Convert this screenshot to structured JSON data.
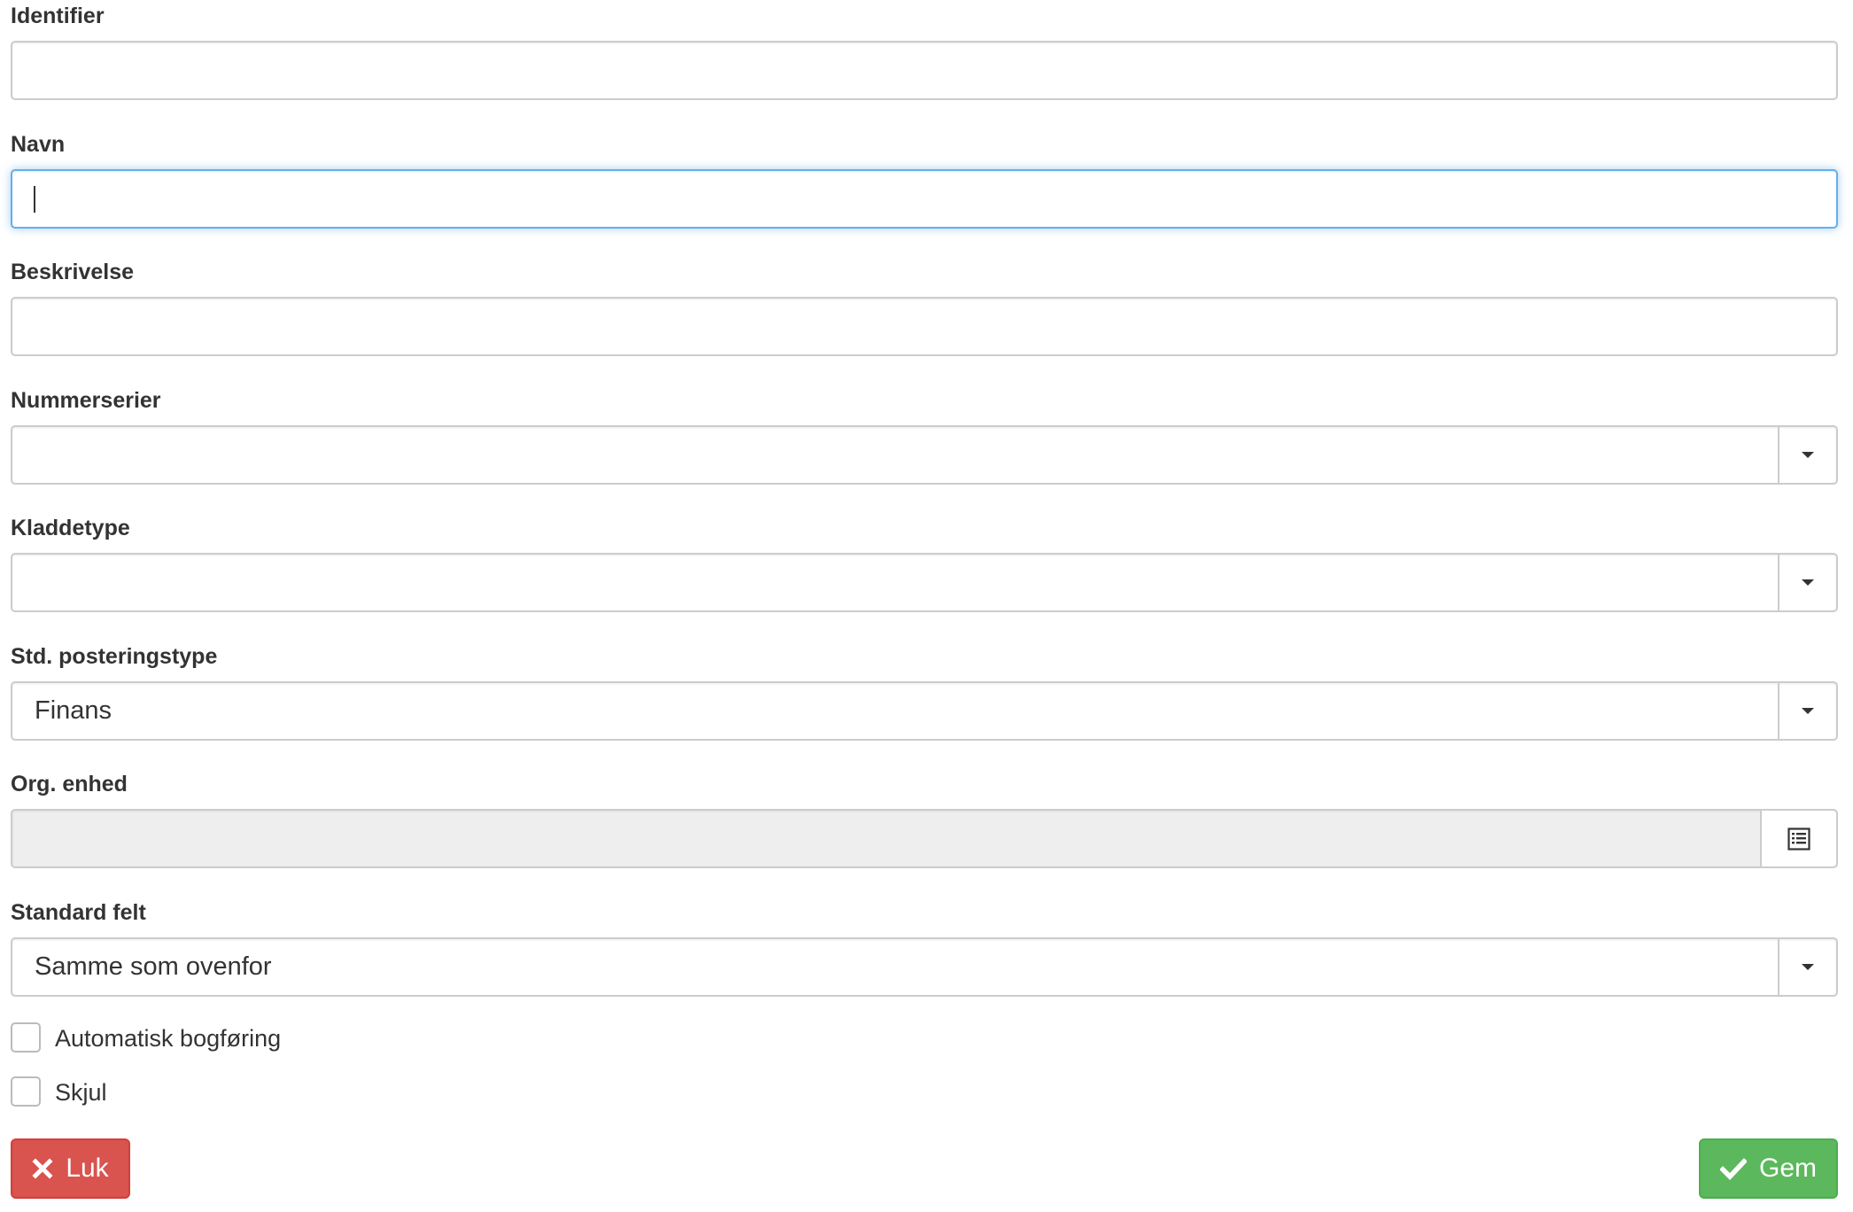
{
  "form": {
    "identifier": {
      "label": "Identifier",
      "value": ""
    },
    "navn": {
      "label": "Navn",
      "value": ""
    },
    "beskrivelse": {
      "label": "Beskrivelse",
      "value": ""
    },
    "nummerserier": {
      "label": "Nummerserier",
      "value": ""
    },
    "kladdetype": {
      "label": "Kladdetype",
      "value": ""
    },
    "std_posteringstype": {
      "label": "Std. posteringstype",
      "value": "Finans"
    },
    "org_enhed": {
      "label": "Org. enhed",
      "value": ""
    },
    "standard_felt": {
      "label": "Standard felt",
      "value": "Samme som ovenfor"
    }
  },
  "checkboxes": {
    "automatisk_bogforing": {
      "label": "Automatisk bogføring",
      "checked": false
    },
    "skjul": {
      "label": "Skjul",
      "checked": false
    }
  },
  "buttons": {
    "close_label": "Luk",
    "save_label": "Gem"
  },
  "icons": {
    "dropdown": "caret-down-icon",
    "picker": "list-icon",
    "close": "times-icon",
    "save": "check-icon"
  },
  "colors": {
    "danger": "#d9534f",
    "success": "#5cb85c",
    "focus": "#66afe9"
  }
}
